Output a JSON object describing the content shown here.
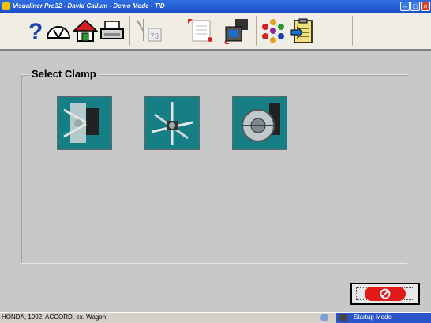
{
  "window": {
    "title": "Visualiner Pro32 - David Callum - Demo Mode - TID"
  },
  "toolbar": {
    "buttons": [
      {
        "icon": "help-icon"
      },
      {
        "icon": "gauge-icon"
      },
      {
        "icon": "home-icon"
      },
      {
        "icon": "printer-icon"
      },
      {
        "icon": "specs-icon",
        "disabled": true,
        "label": "73"
      },
      {
        "icon": "report-icon",
        "disabled": true
      },
      {
        "icon": "transfer-icon"
      },
      {
        "icon": "network-icon"
      },
      {
        "icon": "clipboard-icon"
      }
    ]
  },
  "main": {
    "group_title": "Select Clamp",
    "clamps": [
      {
        "icon": "clamp-type-1-icon"
      },
      {
        "icon": "clamp-type-2-icon"
      },
      {
        "icon": "clamp-type-3-icon"
      }
    ]
  },
  "cancel_button": {
    "icon": "no-entry-icon",
    "color": "#e21a1a"
  },
  "statusbar": {
    "vehicle": "HONDA, 1992, ACCORD, ex. Wagon",
    "mode": "Startup Mode"
  },
  "colors": {
    "title_bar": "#1c4fc8",
    "clamp_tile": "#167f86",
    "background": "#c8c8c8"
  }
}
